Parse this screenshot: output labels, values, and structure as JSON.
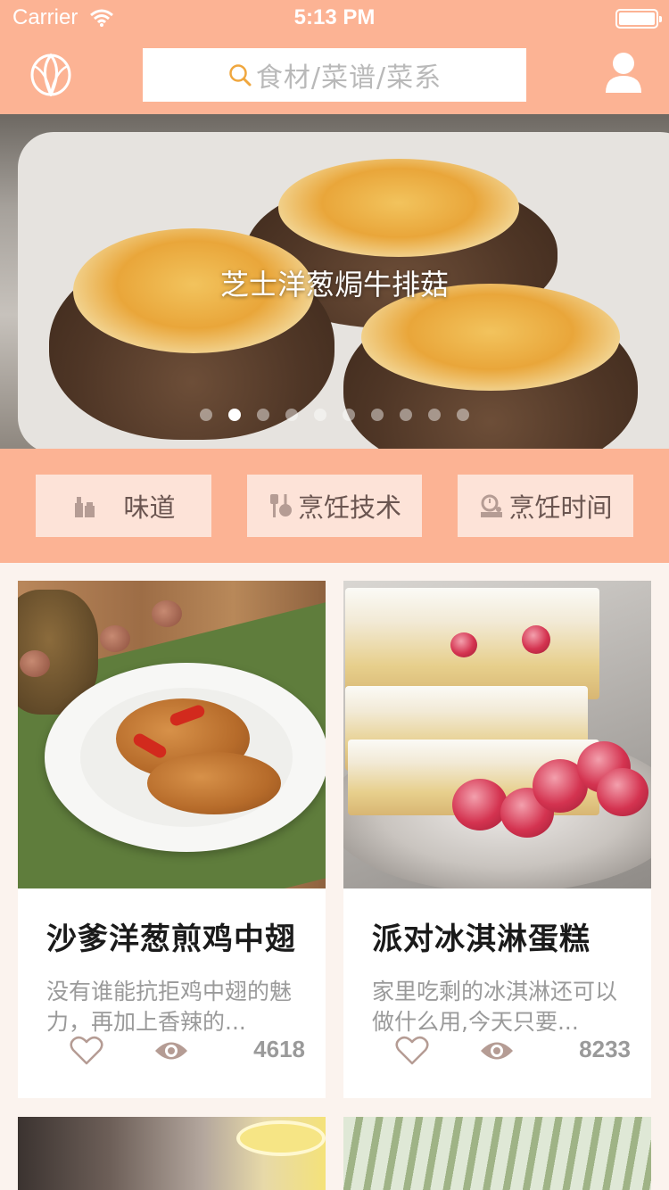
{
  "status_bar": {
    "carrier": "Carrier",
    "time": "5:13 PM"
  },
  "header": {
    "search_placeholder": "食材/菜谱/菜系"
  },
  "banner": {
    "title": "芝士洋葱焗牛排菇",
    "page_count": 10,
    "active_index": 1
  },
  "categories": [
    {
      "label": "味道",
      "icon": "seasoning-bottles-icon"
    },
    {
      "label": "烹饪技术",
      "icon": "utensils-icon"
    },
    {
      "label": "烹饪时间",
      "icon": "timer-scale-icon"
    }
  ],
  "recipes": [
    {
      "title": "沙爹洋葱煎鸡中翅",
      "description": "没有谁能抗拒鸡中翅的魅力，再加上香辣的...",
      "views": "4618"
    },
    {
      "title": "派对冰淇淋蛋糕",
      "description": "家里吃剩的冰淇淋还可以做什么用,今天只要...",
      "views": "8233"
    }
  ],
  "colors": {
    "accent": "#fcb394",
    "category_button": "#fde3d8",
    "icon_grey": "#b59c94"
  }
}
